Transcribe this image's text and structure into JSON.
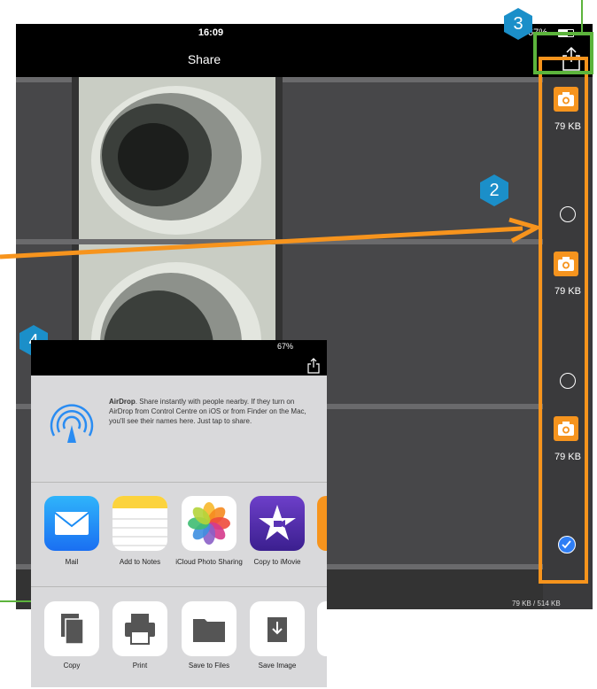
{
  "status": {
    "time": "16:09",
    "battery": "67%"
  },
  "nav": {
    "title": "Share"
  },
  "files": [
    {
      "size": "79 KB",
      "selected": false
    },
    {
      "size": "79 KB",
      "selected": false
    },
    {
      "size": "79 KB",
      "selected": true
    }
  ],
  "footer": {
    "total": "79 KB / 514 KB"
  },
  "annotations": {
    "b2": "2",
    "b3": "3",
    "b4": "4"
  },
  "sheet": {
    "status_battery": "67%",
    "airdrop_title": "AirDrop",
    "airdrop_text": ". Share instantly with people nearby. If they turn on AirDrop from Control Centre on iOS or from Finder on the Mac, you'll see their names here. Just tap to share.",
    "apps": [
      {
        "label": "Mail",
        "icon": "mail-icon"
      },
      {
        "label": "Add to Notes",
        "icon": "notes-icon"
      },
      {
        "label": "iCloud Photo Sharing",
        "icon": "photos-icon"
      },
      {
        "label": "Copy to iMovie",
        "icon": "imovie-icon"
      }
    ],
    "actions": [
      {
        "label": "Copy",
        "icon": "copy-icon"
      },
      {
        "label": "Print",
        "icon": "print-icon"
      },
      {
        "label": "Save to Files",
        "icon": "folder-icon"
      },
      {
        "label": "Save Image",
        "icon": "save-image-icon"
      }
    ]
  },
  "colors": {
    "accent": "#f7941d",
    "annotation_green": "#5cb43c",
    "annotation_blue": "#1b8fc9",
    "check_blue": "#2f7ef5"
  }
}
